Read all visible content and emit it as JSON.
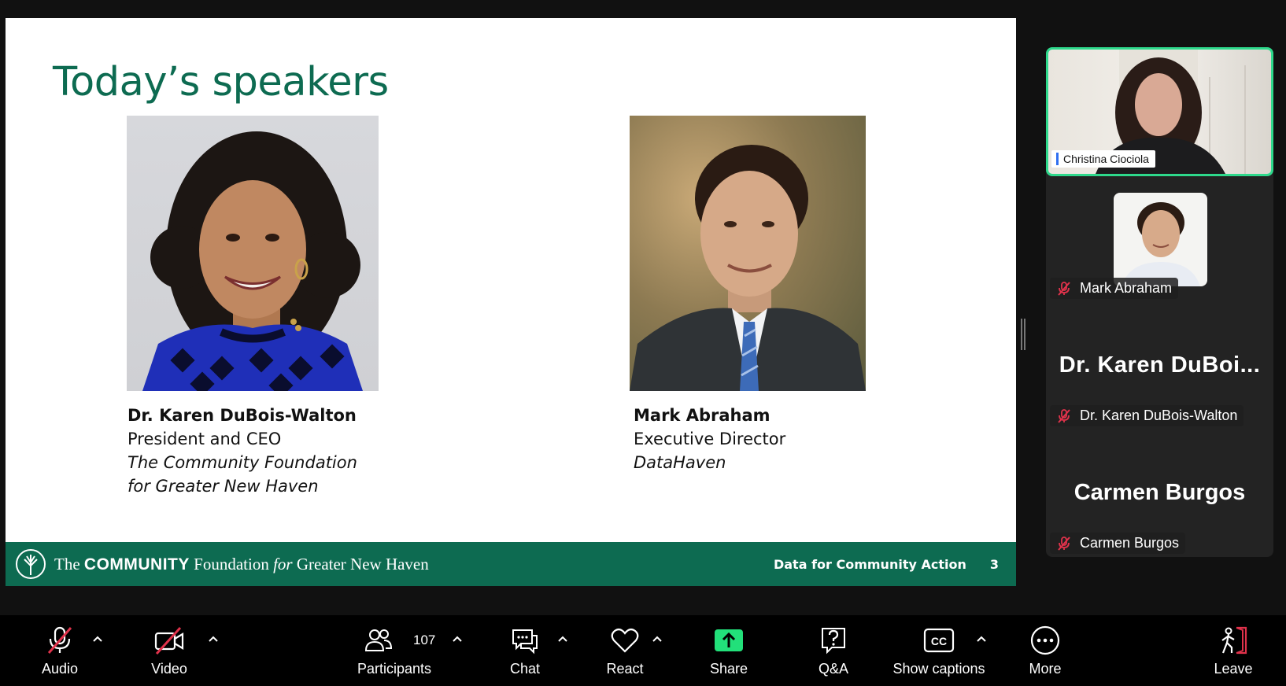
{
  "slide": {
    "title": "Today’s speakers",
    "speakers": [
      {
        "name": "Dr. Karen DuBois-Walton",
        "role": "President and CEO",
        "org_line1": "The Community Foundation",
        "org_line2": "for Greater New Haven"
      },
      {
        "name": "Mark Abraham",
        "role": "Executive Director",
        "org_line1": "DataHaven",
        "org_line2": ""
      }
    ],
    "footer": {
      "brand_the": "The",
      "brand_community": "COMMUNITY",
      "brand_foundation": "Foundation",
      "brand_for": "for",
      "brand_place": "Greater New Haven",
      "tagline": "Data for Community Action",
      "page_number": "3"
    },
    "accent_color": "#0d6b51"
  },
  "participants_panel": {
    "active_speaker": "Christina Ciociola",
    "tiles": [
      {
        "name": "Mark Abraham",
        "muted": true
      },
      {
        "display_name": "Dr. Karen DuBoi...",
        "name": "Dr. Karen DuBois-Walton",
        "muted": true
      },
      {
        "display_name": "Carmen Burgos",
        "name": "Carmen Burgos",
        "muted": true
      }
    ],
    "active_border_color": "#2ed98c"
  },
  "toolbar": {
    "audio": "Audio",
    "video": "Video",
    "participants": "Participants",
    "participants_count": "107",
    "chat": "Chat",
    "react": "React",
    "share": "Share",
    "qa": "Q&A",
    "captions": "Show captions",
    "more": "More",
    "leave": "Leave",
    "share_color": "#22e07a",
    "muted_color": "#e0324b"
  }
}
